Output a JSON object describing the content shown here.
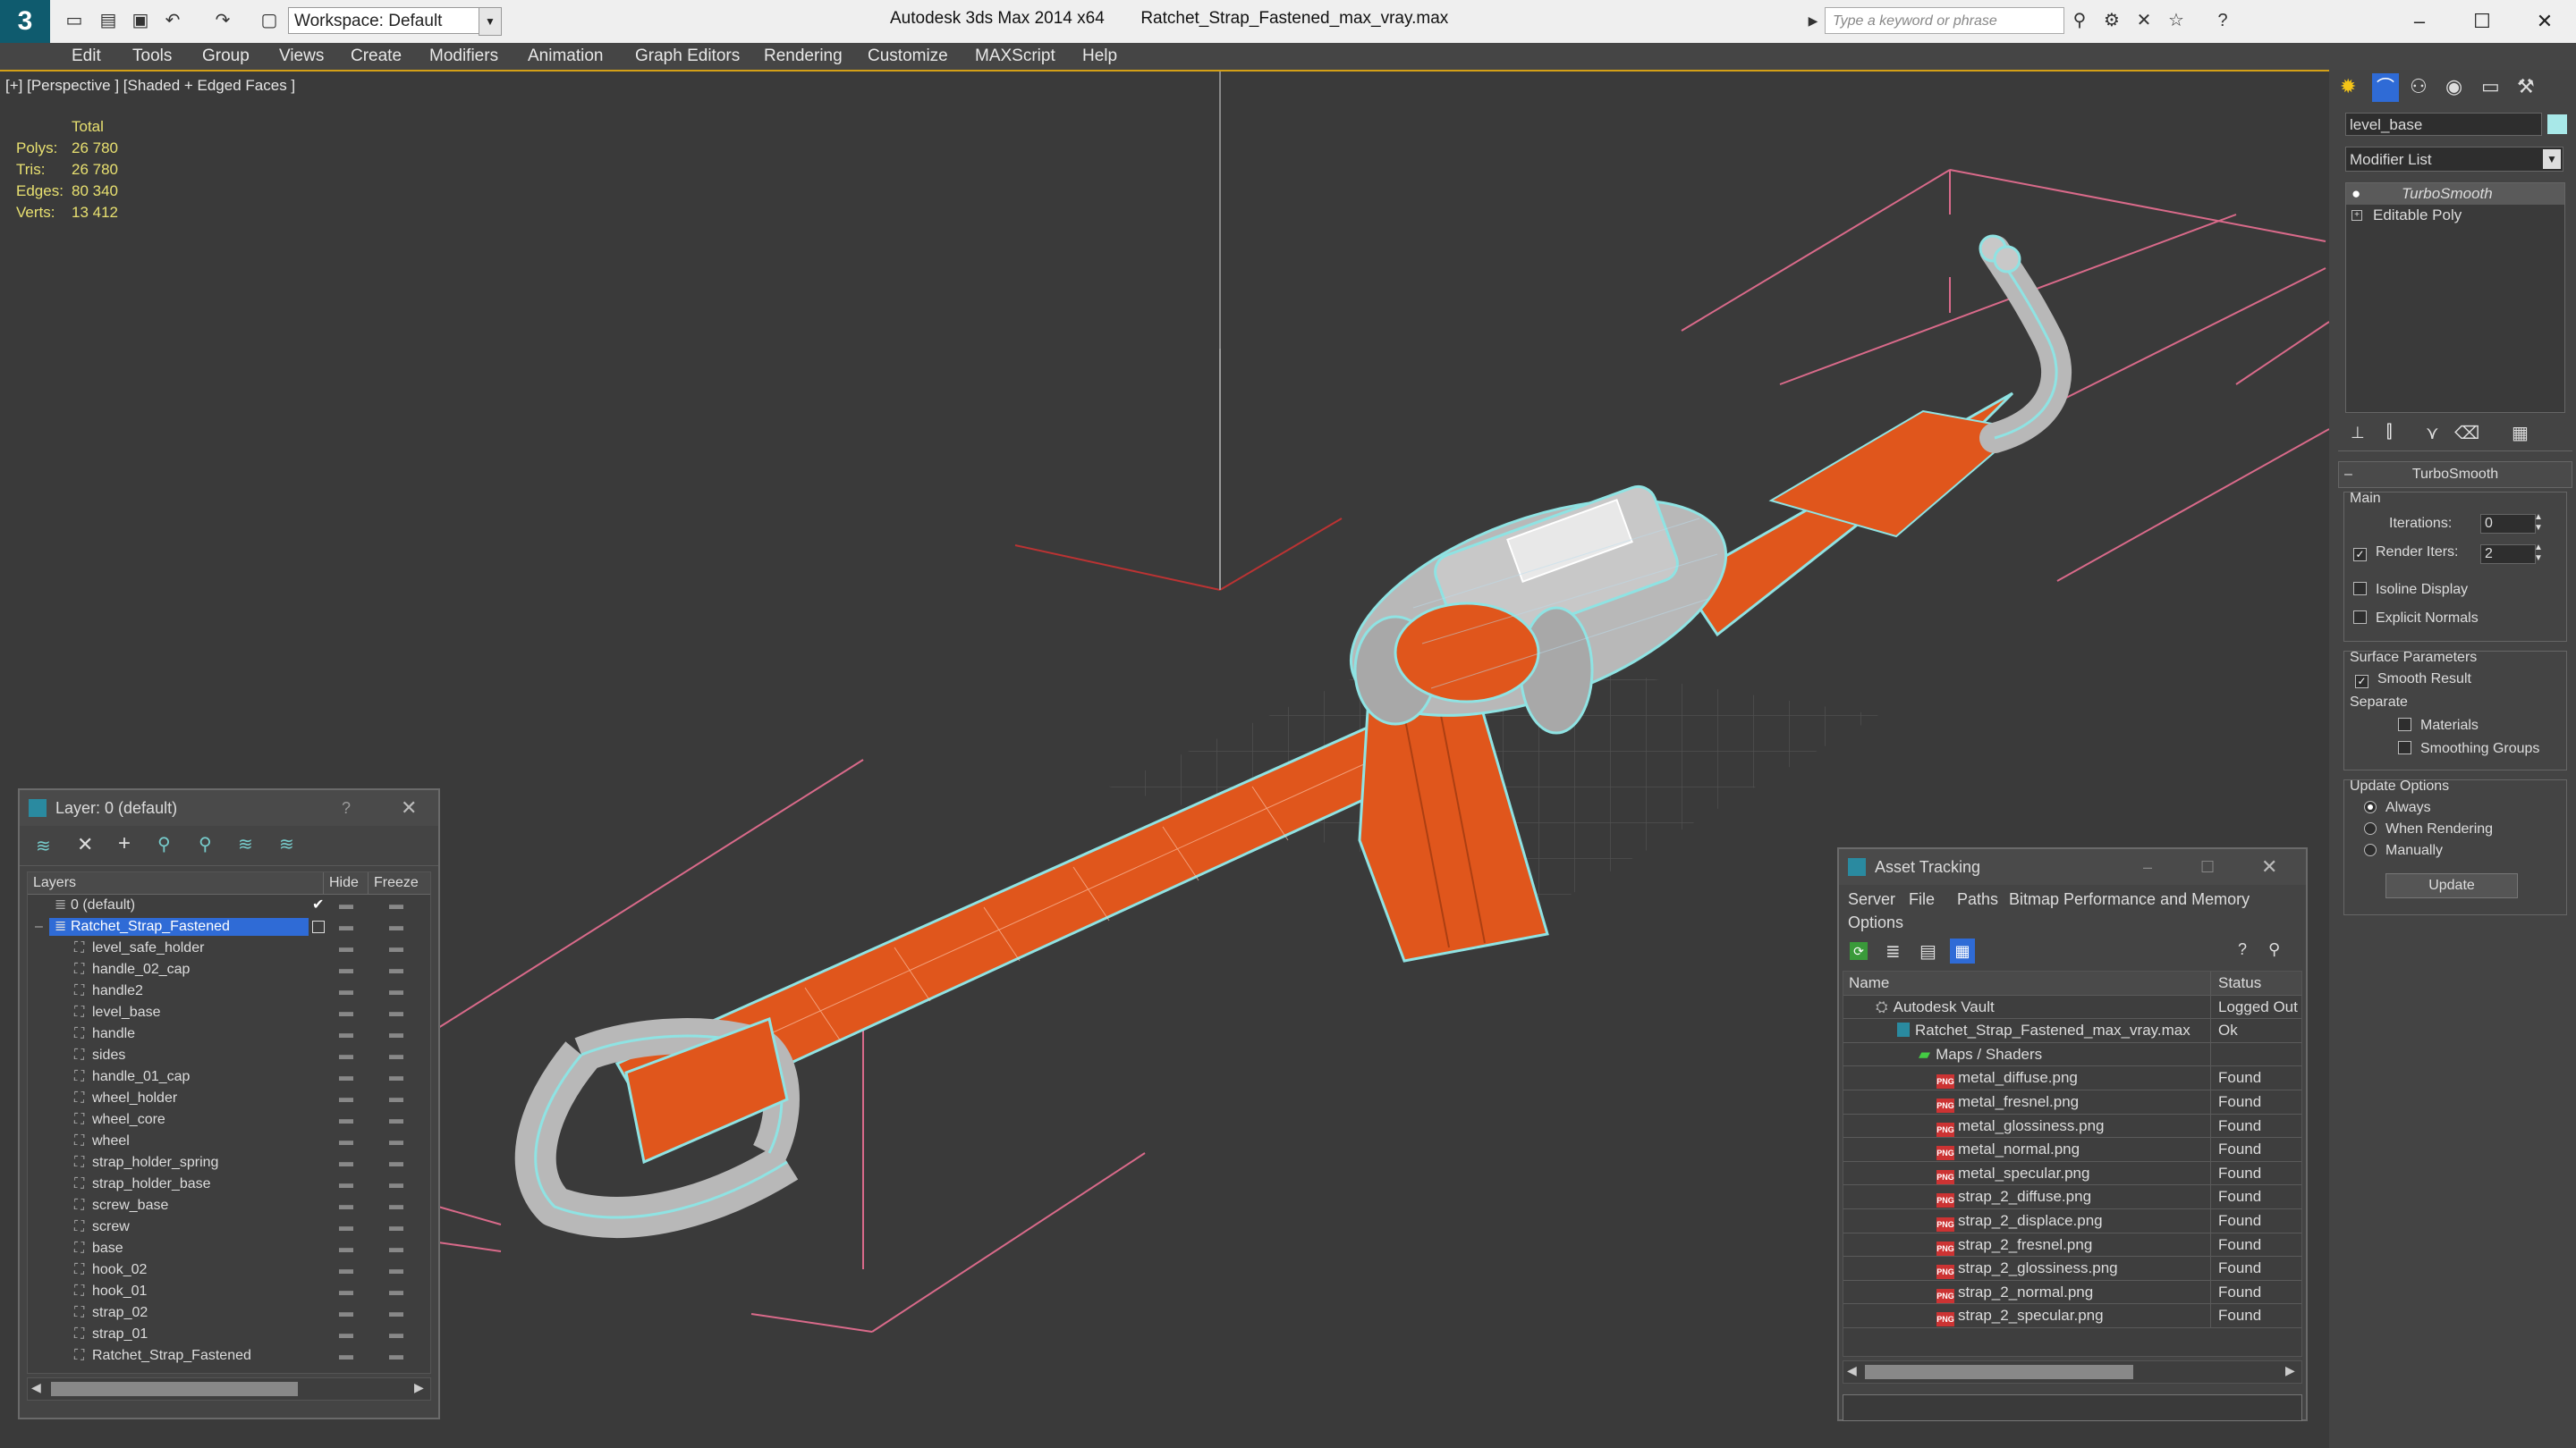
{
  "titlebar": {
    "app": "Autodesk 3ds Max  2014 x64",
    "file": "Ratchet_Strap_Fastened_max_vray.max",
    "workspace": "Workspace: Default",
    "search_placeholder": "Type a keyword or phrase"
  },
  "menu": [
    "Edit",
    "Tools",
    "Group",
    "Views",
    "Create",
    "Modifiers",
    "Animation",
    "Graph Editors",
    "Rendering",
    "Customize",
    "MAXScript",
    "Help"
  ],
  "viewport": {
    "label": "[+] [Perspective ] [Shaded + Edged Faces ]",
    "stats_header": "Total",
    "stats": [
      {
        "k": "Polys:",
        "v": "26 780"
      },
      {
        "k": "Tris:",
        "v": "26 780"
      },
      {
        "k": "Edges:",
        "v": "80 340"
      },
      {
        "k": "Verts:",
        "v": "13 412"
      }
    ]
  },
  "colors": {
    "strap": "#e0561c",
    "metal_wire": "#8fe3e3",
    "frame": "#d96a8a",
    "accent": "#d4a017"
  },
  "layer_panel": {
    "title": "Layer: 0 (default)",
    "help": "?",
    "cols": {
      "name": "Layers",
      "hide": "Hide",
      "freeze": "Freeze"
    },
    "layers": [
      {
        "name": "0 (default)",
        "level": 0,
        "active": true
      },
      {
        "name": "Ratchet_Strap_Fastened",
        "level": 0,
        "selected": true
      }
    ],
    "objects": [
      "level_safe_holder",
      "handle_02_cap",
      "handle2",
      "level_base",
      "handle",
      "sides",
      "handle_01_cap",
      "wheel_holder",
      "wheel_core",
      "wheel",
      "strap_holder_spring",
      "strap_holder_base",
      "screw_base",
      "screw",
      "base",
      "hook_02",
      "hook_01",
      "strap_02",
      "strap_01",
      "Ratchet_Strap_Fastened"
    ]
  },
  "asset_tracking": {
    "title": "Asset Tracking",
    "menu": [
      "Server",
      "File",
      "Paths",
      "Bitmap Performance and Memory"
    ],
    "menu2": "Options",
    "cols": {
      "name": "Name",
      "status": "Status"
    },
    "vault": {
      "name": "Autodesk Vault",
      "status": "Logged Out"
    },
    "file": {
      "name": "Ratchet_Strap_Fastened_max_vray.max",
      "status": "Ok"
    },
    "group": "Maps / Shaders",
    "maps": [
      {
        "name": "metal_diffuse.png",
        "status": "Found"
      },
      {
        "name": "metal_fresnel.png",
        "status": "Found"
      },
      {
        "name": "metal_glossiness.png",
        "status": "Found"
      },
      {
        "name": "metal_normal.png",
        "status": "Found"
      },
      {
        "name": "metal_specular.png",
        "status": "Found"
      },
      {
        "name": "strap_2_diffuse.png",
        "status": "Found"
      },
      {
        "name": "strap_2_displace.png",
        "status": "Found"
      },
      {
        "name": "strap_2_fresnel.png",
        "status": "Found"
      },
      {
        "name": "strap_2_glossiness.png",
        "status": "Found"
      },
      {
        "name": "strap_2_normal.png",
        "status": "Found"
      },
      {
        "name": "strap_2_specular.png",
        "status": "Found"
      }
    ]
  },
  "command_panel": {
    "object_name": "level_base",
    "modifier_list": "Modifier List",
    "stack": [
      "TurboSmooth",
      "Editable Poly"
    ],
    "rollout_title": "TurboSmooth",
    "main": "Main",
    "iterations_label": "Iterations:",
    "iterations": "0",
    "render_iters_label": "Render Iters:",
    "render_iters": "2",
    "isoline": "Isoline Display",
    "explicit_normals": "Explicit Normals",
    "surface_params": "Surface Parameters",
    "smooth_result": "Smooth Result",
    "separate": "Separate",
    "materials": "Materials",
    "smoothing_groups": "Smoothing Groups",
    "update_options": "Update Options",
    "always": "Always",
    "when_rendering": "When Rendering",
    "manually": "Manually",
    "update_btn": "Update"
  }
}
